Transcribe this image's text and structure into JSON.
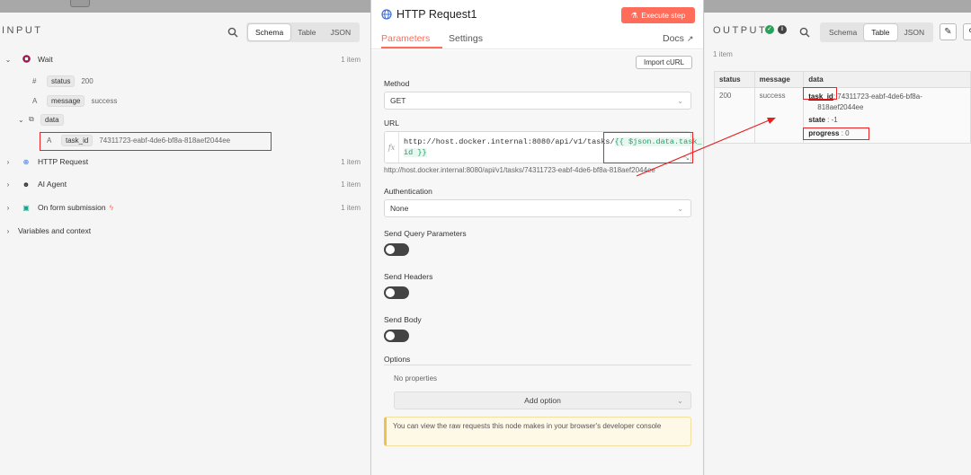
{
  "input": {
    "title": "INPUT",
    "view_tabs": [
      "Schema",
      "Table",
      "JSON"
    ],
    "nodes": [
      {
        "name": "Wait",
        "count": "1 item"
      },
      {
        "name": "HTTP Request",
        "count": "1 item"
      },
      {
        "name": "AI Agent",
        "count": "1 item"
      },
      {
        "name": "On form submission",
        "count": "1 item"
      }
    ],
    "wait_fields": {
      "status": {
        "type": "#",
        "key": "status",
        "value": "200"
      },
      "message": {
        "type": "A",
        "key": "message",
        "value": "success"
      },
      "data": {
        "key": "data"
      },
      "task_id": {
        "type": "A",
        "key": "task_id",
        "value": "74311723-eabf-4de6-bf8a-818aef2044ee"
      }
    },
    "variables_label": "Variables and context"
  },
  "modal": {
    "title": "HTTP Request1",
    "execute_label": "Execute step",
    "tabs": [
      "Parameters",
      "Settings"
    ],
    "docs_label": "Docs",
    "import_label": "Import cURL",
    "method_label": "Method",
    "method_value": "GET",
    "url_label": "URL",
    "url_prefix": "http://host.docker.internal:8080/api/v1/tasks/",
    "url_expr_1": "{{ $json.data.task_",
    "url_expr_2": "id }}",
    "url_resolved": "http://host.docker.internal:8080/api/v1/tasks/74311723-eabf-4de6-bf8a-818aef2044ee",
    "auth_label": "Authentication",
    "auth_value": "None",
    "send_query_label": "Send Query Parameters",
    "send_headers_label": "Send Headers",
    "send_body_label": "Send Body",
    "options_label": "Options",
    "no_props": "No properties",
    "add_option": "Add option",
    "notice": "You can view the raw requests this node makes in your browser's developer console"
  },
  "output": {
    "title": "OUTPUT",
    "item_count": "1 item",
    "view_tabs": [
      "Schema",
      "Table",
      "JSON"
    ],
    "columns": [
      "status",
      "message",
      "data"
    ],
    "row": {
      "status": "200",
      "message": "success",
      "task_id_key": "task_id",
      "task_id_value": ": 74311723-eabf-4de6-bf8a-",
      "task_id_value2": "818aef2044ee",
      "state_key": "state",
      "state_value": ": -1",
      "progress_key": "progress",
      "progress_value": ": 0"
    }
  },
  "colors": {
    "accent": "#ff6d5a",
    "expression": "#1fa36a",
    "annotation": "#e22222"
  }
}
